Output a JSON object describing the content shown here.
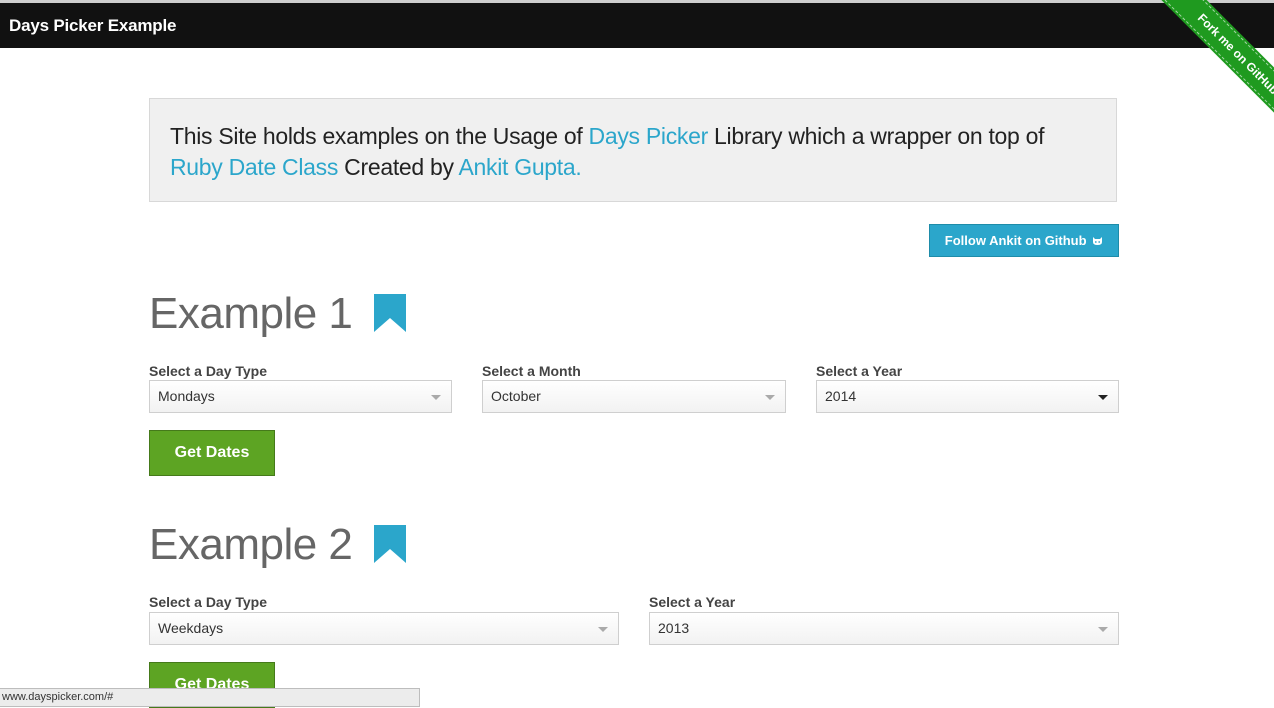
{
  "navbar": {
    "brand": "Days Picker Example"
  },
  "ribbon": {
    "label": "Fork me on GitHub",
    "color": "#1f9a1f"
  },
  "hero": {
    "text1": "This Site holds examples on the Usage of ",
    "link1": "Days Picker",
    "text2": " Library which a wrapper on top of ",
    "link2": "Ruby Date Class",
    "text3": " Created by ",
    "link3": "Ankit Gupta."
  },
  "follow_button": {
    "label": "Follow Ankit on Github",
    "icon": "octocat-icon"
  },
  "example1": {
    "title": "Example 1",
    "day_type": {
      "label": "Select a Day Type",
      "value": "Mondays"
    },
    "month": {
      "label": "Select a Month",
      "value": "October"
    },
    "year": {
      "label": "Select a Year",
      "value": "2014"
    },
    "button": "Get Dates"
  },
  "example2": {
    "title": "Example 2",
    "day_type": {
      "label": "Select a Day Type",
      "value": "Weekdays"
    },
    "year": {
      "label": "Select a Year",
      "value": "2013"
    },
    "button": "Get Dates"
  },
  "status_bar": {
    "url": "www.dayspicker.com/#"
  },
  "colors": {
    "accent": "#2ba6cb",
    "success": "#5da423",
    "navbar": "#111111"
  }
}
